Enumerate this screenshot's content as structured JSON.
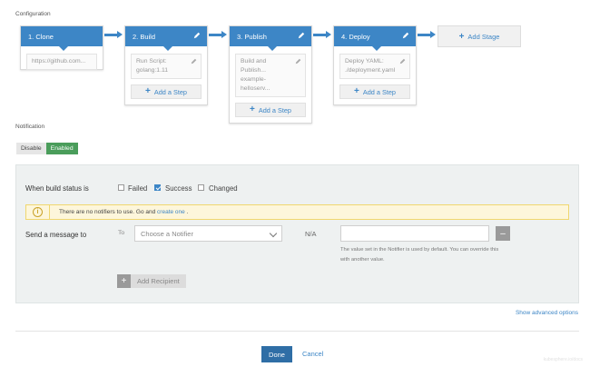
{
  "configuration": {
    "label": "Configuration",
    "stages": [
      {
        "title": "1. Clone",
        "editable": false,
        "steps": [
          {
            "text": "https://github.com..."
          }
        ],
        "add_step_label": null
      },
      {
        "title": "2. Build",
        "editable": true,
        "steps": [
          {
            "text": "Run Script:\ngolang:1.11"
          }
        ],
        "add_step_label": "Add a Step"
      },
      {
        "title": "3. Publish",
        "editable": true,
        "steps": [
          {
            "text": "Build and Publish...\nexample-helloserv..."
          }
        ],
        "add_step_label": "Add a Step"
      },
      {
        "title": "4. Deploy",
        "editable": true,
        "steps": [
          {
            "text": "Deploy YAML:\n./deployment.yaml"
          }
        ],
        "add_step_label": "Add a Step"
      }
    ],
    "add_stage_label": "Add Stage"
  },
  "notification": {
    "label": "Notification",
    "toggle": {
      "off_label": "Disable",
      "on_label": "Enabled",
      "selected": "Enabled"
    },
    "build_status": {
      "label": "When build status is",
      "options": [
        {
          "label": "Failed",
          "checked": false
        },
        {
          "label": "Success",
          "checked": true
        },
        {
          "label": "Changed",
          "checked": false
        }
      ]
    },
    "warning": {
      "icon": "info-icon",
      "text": "There are no notifiers to use. Go and",
      "link": "create one",
      "suffix": "."
    },
    "send": {
      "label": "Send a message to",
      "to_label": "To",
      "select_placeholder": "Choose a Notifier",
      "na_label": "N/A",
      "value": "",
      "hint": "The value set in the Notifier is used by default. You can override this with another value."
    },
    "add_recipient_label": "Add Recipient",
    "advanced_link": "Show advanced options"
  },
  "footer": {
    "done_label": "Done",
    "cancel_label": "Cancel",
    "watermark": "kubesphere.io/docs"
  },
  "colors": {
    "accent": "#3d86c6",
    "enabled": "#4a9d5b",
    "primary_button": "#2f6ea6",
    "warning_bg": "#fdf6db"
  }
}
